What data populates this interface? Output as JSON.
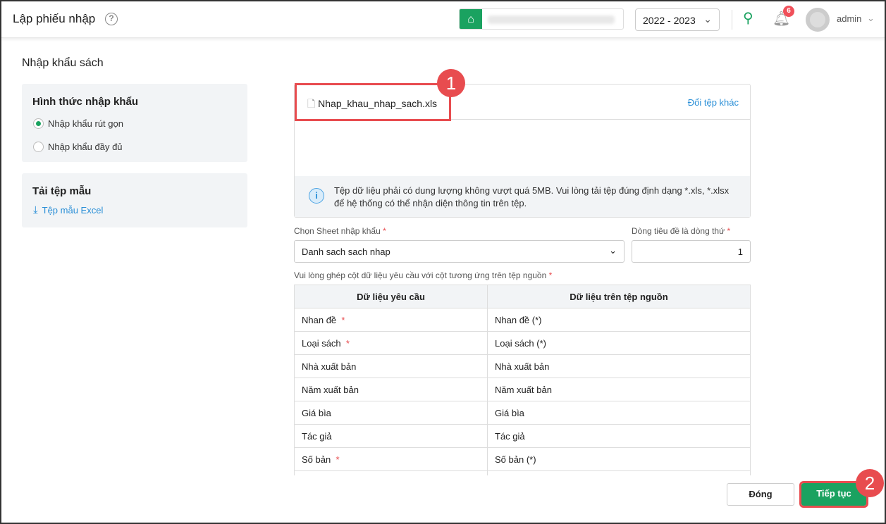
{
  "header": {
    "title": "Lập phiếu nhập",
    "year": "2022 - 2023",
    "notif_count": "6",
    "user": "admin"
  },
  "section_title": "Nhập khẩu sách",
  "import_type": {
    "title": "Hình thức nhập khẩu",
    "options": [
      "Nhập khẩu rút gọn",
      "Nhập khẩu đầy đủ"
    ],
    "selected": 0
  },
  "template": {
    "title": "Tải tệp mẫu",
    "link": "Tệp mẫu Excel"
  },
  "upload": {
    "file_name": "Nhap_khau_nhap_sach.xls",
    "change": "Đổi tệp khác",
    "info": "Tệp dữ liệu phải có dung lượng không vượt quá 5MB. Vui lòng tải tệp đúng định dạng *.xls, *.xlsx để hệ thống có thể nhận diện thông tin trên tệp."
  },
  "sheet": {
    "label": "Chọn Sheet nhập khẩu",
    "value": "Danh sach sach nhap"
  },
  "header_row": {
    "label": "Dòng tiêu đề là dòng thứ",
    "value": "1"
  },
  "mapping": {
    "label": "Vui lòng ghép cột dữ liệu yêu cầu với cột tương ứng trên tệp nguồn",
    "columns": [
      "Dữ liệu yêu cầu",
      "Dữ liệu trên tệp nguồn"
    ],
    "rows": [
      [
        "Nhan đề",
        "Nhan đề (*)",
        true
      ],
      [
        "Loại sách",
        "Loại sách (*)",
        true
      ],
      [
        "Nhà xuất bản",
        "Nhà xuất bản",
        false
      ],
      [
        "Năm xuất bản",
        "Năm xuất bản",
        false
      ],
      [
        "Giá bìa",
        "Giá bìa",
        false
      ],
      [
        "Tác giả",
        "Tác giả",
        false
      ],
      [
        "Số bản",
        "Số bản (*)",
        true
      ],
      [
        "",
        ""
      ]
    ]
  },
  "annotations": [
    "1",
    "2"
  ],
  "buttons": {
    "close": "Đóng",
    "next": "Tiếp tục"
  }
}
